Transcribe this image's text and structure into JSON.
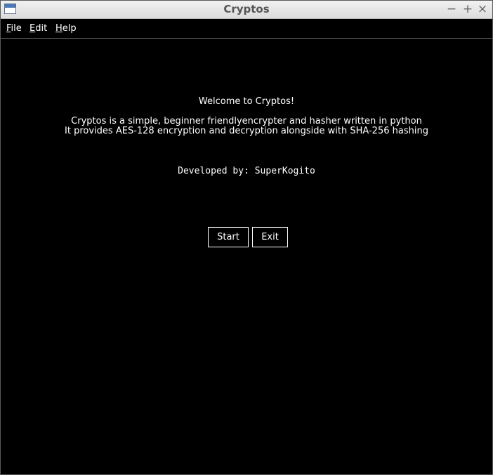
{
  "window": {
    "title": "Cryptos",
    "controls": {
      "minimize": "−",
      "maximize": "+",
      "close": "×"
    }
  },
  "menubar": {
    "file": {
      "mnemonic": "F",
      "rest": "ile"
    },
    "edit": {
      "mnemonic": "E",
      "rest": "dit"
    },
    "help": {
      "mnemonic": "H",
      "rest": "elp"
    }
  },
  "main": {
    "welcome": "Welcome to Cryptos!",
    "description_line1": "Cryptos is a simple, beginner friendlyencrypter and hasher written in python",
    "description_line2": "It provides AES-128 encryption and decryption alongside with SHA-256 hashing",
    "developer": "Developed by: SuperKogito",
    "start_label": "Start",
    "exit_label": "Exit"
  },
  "colors": {
    "background": "#000000",
    "text": "#ffffff",
    "titlebar": "#e6e6e6"
  }
}
